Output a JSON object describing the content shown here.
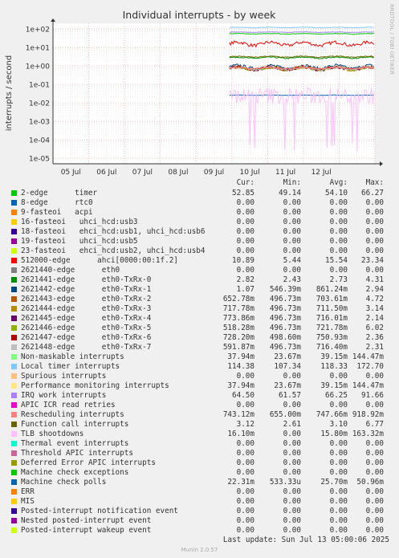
{
  "chart_data": {
    "type": "line",
    "title": "Individual interrupts - by week",
    "ylabel": "interrupts / second",
    "yscale": "log",
    "ylim": [
      5e-06,
      200
    ],
    "y_ticks": [
      "1e+02",
      "1e+01",
      "1e+00",
      "1e-01",
      "1e-02",
      "1e-03",
      "1e-04",
      "1e-05"
    ],
    "x_ticks": [
      "05 Jul",
      "06 Jul",
      "07 Jul",
      "08 Jul",
      "09 Jul",
      "10 Jul",
      "11 Jul",
      "12 Jul"
    ],
    "x_range": [
      "04 Jul",
      "13 Jul"
    ],
    "data_start": "09 Jul",
    "grid": true,
    "watermark": "RRDTOOL / TOBI OETIKER",
    "columns": [
      "Cur:",
      "Min:",
      "Avg:",
      "Max:"
    ],
    "series": [
      {
        "name": "2-edge      timer",
        "color": "#00cc00",
        "cur": "52.85",
        "min": "49.14",
        "avg": "54.10",
        "max": "66.27",
        "level": 54.1,
        "spread": 0.06
      },
      {
        "name": "8-edge      rtc0",
        "color": "#0066b3",
        "cur": "0.00",
        "min": "0.00",
        "avg": "0.00",
        "max": "0.00"
      },
      {
        "name": "9-fasteoi   acpi",
        "color": "#ff8000",
        "cur": "0.00",
        "min": "0.00",
        "avg": "0.00",
        "max": "0.00"
      },
      {
        "name": "16-fasteoi   uhci_hcd:usb3",
        "color": "#ffcc00",
        "cur": "0.00",
        "min": "0.00",
        "avg": "0.00",
        "max": "0.00"
      },
      {
        "name": "18-fasteoi   ehci_hcd:usb1, uhci_hcd:usb6",
        "color": "#330099",
        "cur": "0.00",
        "min": "0.00",
        "avg": "0.00",
        "max": "0.00"
      },
      {
        "name": "19-fasteoi   uhci_hcd:usb5",
        "color": "#990099",
        "cur": "0.00",
        "min": "0.00",
        "avg": "0.00",
        "max": "0.00"
      },
      {
        "name": "23-fasteoi   ehci_hcd:usb2, uhci_hcd:usb4",
        "color": "#ccff00",
        "cur": "0.00",
        "min": "0.00",
        "avg": "0.00",
        "max": "0.00"
      },
      {
        "name": "512000-edge      ahci[0000:00:1f.2]",
        "color": "#ff0000",
        "cur": "10.89",
        "min": "5.44",
        "avg": "15.54",
        "max": "23.34",
        "level": 15.5,
        "spread": 0.35
      },
      {
        "name": "2621440-edge      eth0",
        "color": "#808080",
        "cur": "0.00",
        "min": "0.00",
        "avg": "0.00",
        "max": "0.00"
      },
      {
        "name": "2621441-edge      eth0-TxRx-0",
        "color": "#008f00",
        "cur": "2.82",
        "min": "2.43",
        "avg": "2.73",
        "max": "4.31",
        "level": 2.73,
        "spread": 0.12
      },
      {
        "name": "2621442-edge      eth0-TxRx-1",
        "color": "#00487d",
        "cur": "1.07",
        "min": "546.39m",
        "avg": "861.24m",
        "max": "2.94",
        "level": 0.86,
        "spread": 0.35
      },
      {
        "name": "2621443-edge      eth0-TxRx-2",
        "color": "#b35a00",
        "cur": "652.78m",
        "min": "496.73m",
        "avg": "703.61m",
        "max": "4.72",
        "level": 0.7,
        "spread": 0.3
      },
      {
        "name": "2621444-edge      eth0-TxRx-3",
        "color": "#b38f00",
        "cur": "717.78m",
        "min": "496.73m",
        "avg": "711.50m",
        "max": "3.14",
        "level": 0.71,
        "spread": 0.3
      },
      {
        "name": "2621445-edge      eth0-TxRx-4",
        "color": "#6b006b",
        "cur": "773.86m",
        "min": "496.73m",
        "avg": "716.01m",
        "max": "2.14",
        "level": 0.72,
        "spread": 0.3
      },
      {
        "name": "2621446-edge      eth0-TxRx-5",
        "color": "#8fb300",
        "cur": "518.28m",
        "min": "496.73m",
        "avg": "721.78m",
        "max": "6.02",
        "level": 0.72,
        "spread": 0.3
      },
      {
        "name": "2621447-edge      eth0-TxRx-6",
        "color": "#b30000",
        "cur": "728.20m",
        "min": "498.60m",
        "avg": "750.93m",
        "max": "2.36",
        "level": 0.75,
        "spread": 0.3
      },
      {
        "name": "2621448-edge      eth0-TxRx-7",
        "color": "#bebebe",
        "cur": "591.87m",
        "min": "496.73m",
        "avg": "716.40m",
        "max": "2.31",
        "level": 0.72,
        "spread": 0.3
      },
      {
        "name": "Non-maskable interrupts",
        "color": "#80ff80",
        "cur": "37.94m",
        "min": "23.67m",
        "avg": "39.15m",
        "max": "144.47m"
      },
      {
        "name": "Local timer interrupts",
        "color": "#80c9ff",
        "cur": "114.38",
        "min": "107.34",
        "avg": "118.33",
        "max": "172.70",
        "level": 118.3,
        "spread": 0.05
      },
      {
        "name": "Spurious interrupts",
        "color": "#ffc080",
        "cur": "0.00",
        "min": "0.00",
        "avg": "0.00",
        "max": "0.00"
      },
      {
        "name": "Performance monitoring interrupts",
        "color": "#ffe680",
        "cur": "37.94m",
        "min": "23.67m",
        "avg": "39.15m",
        "max": "144.47m"
      },
      {
        "name": "IRQ work interrupts",
        "color": "#aa80ff",
        "cur": "64.50",
        "min": "61.57",
        "avg": "66.25",
        "max": "91.66",
        "level": 66.2,
        "spread": 0.04
      },
      {
        "name": "APIC ICR read retries",
        "color": "#ee00cc",
        "cur": "0.00",
        "min": "0.00",
        "avg": "0.00",
        "max": "0.00"
      },
      {
        "name": "Rescheduling interrupts",
        "color": "#ff8080",
        "cur": "743.12m",
        "min": "655.00m",
        "avg": "747.66m",
        "max": "918.92m",
        "level": 0.75,
        "spread": 0.12
      },
      {
        "name": "Function call interrupts",
        "color": "#666600",
        "cur": "3.12",
        "min": "2.61",
        "avg": "3.10",
        "max": "6.77",
        "level": 3.1,
        "spread": 0.1
      },
      {
        "name": "TLB shootdowns",
        "color": "#ffbfff",
        "cur": "16.10m",
        "min": "0.00",
        "avg": "15.80m",
        "max": "163.32m"
      },
      {
        "name": "Thermal event interrupts",
        "color": "#00ffcc",
        "cur": "0.00",
        "min": "0.00",
        "avg": "0.00",
        "max": "0.00"
      },
      {
        "name": "Threshold APIC interrupts",
        "color": "#cc6699",
        "cur": "0.00",
        "min": "0.00",
        "avg": "0.00",
        "max": "0.00"
      },
      {
        "name": "Deferred Error APIC interrupts",
        "color": "#999900",
        "cur": "0.00",
        "min": "0.00",
        "avg": "0.00",
        "max": "0.00"
      },
      {
        "name": "Machine check exceptions",
        "color": "#00cc00",
        "cur": "0.00",
        "min": "0.00",
        "avg": "0.00",
        "max": "0.00"
      },
      {
        "name": "Machine check polls",
        "color": "#0066b3",
        "cur": "22.31m",
        "min": "533.33u",
        "avg": "25.70m",
        "max": "50.96m",
        "level": 0.0257,
        "spread": 0.03
      },
      {
        "name": "ERR",
        "color": "#ff8000",
        "cur": "0.00",
        "min": "0.00",
        "avg": "0.00",
        "max": "0.00"
      },
      {
        "name": "MIS",
        "color": "#ffcc00",
        "cur": "0.00",
        "min": "0.00",
        "avg": "0.00",
        "max": "0.00"
      },
      {
        "name": "Posted-interrupt notification event",
        "color": "#330099",
        "cur": "0.00",
        "min": "0.00",
        "avg": "0.00",
        "max": "0.00"
      },
      {
        "name": "Nested posted-interrupt event",
        "color": "#990099",
        "cur": "0.00",
        "min": "0.00",
        "avg": "0.00",
        "max": "0.00"
      },
      {
        "name": "Posted-interrupt wakeup event",
        "color": "#ccff00",
        "cur": "0.00",
        "min": "0.00",
        "avg": "0.00",
        "max": "0.00"
      }
    ]
  },
  "footer": {
    "last_update": "Last update:  Sun Jul 13 05:00:06 2025",
    "munin": "Munin 2.0.57"
  }
}
